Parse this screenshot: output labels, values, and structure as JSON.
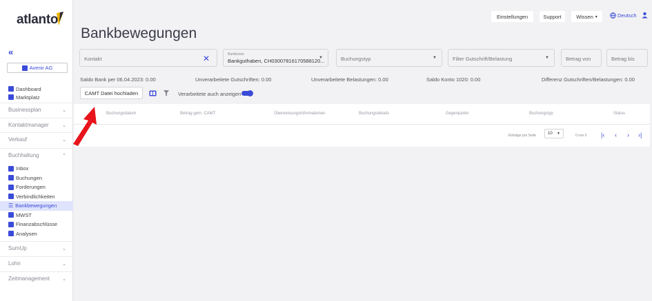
{
  "brand": {
    "name": "atlanto"
  },
  "sidebar": {
    "collapse": "«",
    "company": "Avenir AG",
    "top_items": [
      {
        "label": "Dashboard"
      },
      {
        "label": "Marktplatz"
      }
    ],
    "sections": {
      "businessplan": "Businessplan",
      "kontaktmanager": "Kontaktmanager",
      "verkauf": "Verkauf",
      "buchhaltung": "Buchhaltung",
      "sumup": "SumUp",
      "lohn": "Lohn",
      "zeitmanagement": "Zeitmanagement"
    },
    "buchhaltung_items": [
      {
        "label": "Inbox"
      },
      {
        "label": "Buchungen"
      },
      {
        "label": "Forderungen"
      },
      {
        "label": "Verbindlichkeiten"
      },
      {
        "label": "Bankbewegungen"
      },
      {
        "label": "MWST"
      },
      {
        "label": "Finanzabschlüsse"
      },
      {
        "label": "Analysen"
      }
    ]
  },
  "topbar": {
    "settings": "Einstellungen",
    "support": "Support",
    "wissen": "Wissen",
    "language": "Deutsch"
  },
  "page": {
    "title": "Bankbewegungen"
  },
  "filters": {
    "kontakt_placeholder": "Kontakt",
    "bankkonto_label": "Bankkonto",
    "bankkonto_value": "Bankguthaben, CH03007816170588120...",
    "buchungstyp_placeholder": "Buchungstyp",
    "gutschrift_placeholder": "Filter Gutschrift/Belastung",
    "betrag_von": "Betrag von",
    "betrag_bis": "Betrag bis"
  },
  "summary": {
    "saldo_bank": "Saldo Bank per 06.04.2023: 0.00",
    "unverarb_gutschriften": "Unverarbeitete Gutschriften: 0.00",
    "unverarb_belastungen": "Unverarbeitete Belastungen: 0.00",
    "saldo_konto": "Saldo Konto 1020: 0.00",
    "differenz": "Differenz Gutschriften/Belastungen: 0.00"
  },
  "actions": {
    "camt_upload": "CAMT Datei hochladen",
    "show_processed": "Verarbeitete auch anzeigen"
  },
  "table": {
    "columns": [
      "Buchungsdatum",
      "Betrag gem. CAMT",
      "Überweisungsinformationen",
      "Buchungsdetails",
      "Gegenpartei",
      "Buchungstyp",
      "Status"
    ],
    "rows_per_page_label": "Einträge pro Seite",
    "rows_per_page": "10",
    "range": "0 von 0"
  },
  "colors": {
    "accent": "#3a4bd8",
    "arrow": "#e8141b"
  }
}
